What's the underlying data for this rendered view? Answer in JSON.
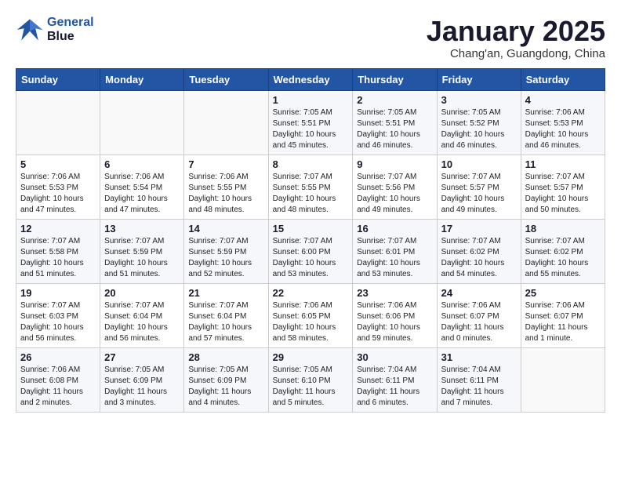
{
  "header": {
    "logo_line1": "General",
    "logo_line2": "Blue",
    "month_title": "January 2025",
    "subtitle": "Chang'an, Guangdong, China"
  },
  "weekdays": [
    "Sunday",
    "Monday",
    "Tuesday",
    "Wednesday",
    "Thursday",
    "Friday",
    "Saturday"
  ],
  "weeks": [
    [
      {
        "day": "",
        "info": ""
      },
      {
        "day": "",
        "info": ""
      },
      {
        "day": "",
        "info": ""
      },
      {
        "day": "1",
        "info": "Sunrise: 7:05 AM\nSunset: 5:51 PM\nDaylight: 10 hours\nand 45 minutes."
      },
      {
        "day": "2",
        "info": "Sunrise: 7:05 AM\nSunset: 5:51 PM\nDaylight: 10 hours\nand 46 minutes."
      },
      {
        "day": "3",
        "info": "Sunrise: 7:05 AM\nSunset: 5:52 PM\nDaylight: 10 hours\nand 46 minutes."
      },
      {
        "day": "4",
        "info": "Sunrise: 7:06 AM\nSunset: 5:53 PM\nDaylight: 10 hours\nand 46 minutes."
      }
    ],
    [
      {
        "day": "5",
        "info": "Sunrise: 7:06 AM\nSunset: 5:53 PM\nDaylight: 10 hours\nand 47 minutes."
      },
      {
        "day": "6",
        "info": "Sunrise: 7:06 AM\nSunset: 5:54 PM\nDaylight: 10 hours\nand 47 minutes."
      },
      {
        "day": "7",
        "info": "Sunrise: 7:06 AM\nSunset: 5:55 PM\nDaylight: 10 hours\nand 48 minutes."
      },
      {
        "day": "8",
        "info": "Sunrise: 7:07 AM\nSunset: 5:55 PM\nDaylight: 10 hours\nand 48 minutes."
      },
      {
        "day": "9",
        "info": "Sunrise: 7:07 AM\nSunset: 5:56 PM\nDaylight: 10 hours\nand 49 minutes."
      },
      {
        "day": "10",
        "info": "Sunrise: 7:07 AM\nSunset: 5:57 PM\nDaylight: 10 hours\nand 49 minutes."
      },
      {
        "day": "11",
        "info": "Sunrise: 7:07 AM\nSunset: 5:57 PM\nDaylight: 10 hours\nand 50 minutes."
      }
    ],
    [
      {
        "day": "12",
        "info": "Sunrise: 7:07 AM\nSunset: 5:58 PM\nDaylight: 10 hours\nand 51 minutes."
      },
      {
        "day": "13",
        "info": "Sunrise: 7:07 AM\nSunset: 5:59 PM\nDaylight: 10 hours\nand 51 minutes."
      },
      {
        "day": "14",
        "info": "Sunrise: 7:07 AM\nSunset: 5:59 PM\nDaylight: 10 hours\nand 52 minutes."
      },
      {
        "day": "15",
        "info": "Sunrise: 7:07 AM\nSunset: 6:00 PM\nDaylight: 10 hours\nand 53 minutes."
      },
      {
        "day": "16",
        "info": "Sunrise: 7:07 AM\nSunset: 6:01 PM\nDaylight: 10 hours\nand 53 minutes."
      },
      {
        "day": "17",
        "info": "Sunrise: 7:07 AM\nSunset: 6:02 PM\nDaylight: 10 hours\nand 54 minutes."
      },
      {
        "day": "18",
        "info": "Sunrise: 7:07 AM\nSunset: 6:02 PM\nDaylight: 10 hours\nand 55 minutes."
      }
    ],
    [
      {
        "day": "19",
        "info": "Sunrise: 7:07 AM\nSunset: 6:03 PM\nDaylight: 10 hours\nand 56 minutes."
      },
      {
        "day": "20",
        "info": "Sunrise: 7:07 AM\nSunset: 6:04 PM\nDaylight: 10 hours\nand 56 minutes."
      },
      {
        "day": "21",
        "info": "Sunrise: 7:07 AM\nSunset: 6:04 PM\nDaylight: 10 hours\nand 57 minutes."
      },
      {
        "day": "22",
        "info": "Sunrise: 7:06 AM\nSunset: 6:05 PM\nDaylight: 10 hours\nand 58 minutes."
      },
      {
        "day": "23",
        "info": "Sunrise: 7:06 AM\nSunset: 6:06 PM\nDaylight: 10 hours\nand 59 minutes."
      },
      {
        "day": "24",
        "info": "Sunrise: 7:06 AM\nSunset: 6:07 PM\nDaylight: 11 hours\nand 0 minutes."
      },
      {
        "day": "25",
        "info": "Sunrise: 7:06 AM\nSunset: 6:07 PM\nDaylight: 11 hours\nand 1 minute."
      }
    ],
    [
      {
        "day": "26",
        "info": "Sunrise: 7:06 AM\nSunset: 6:08 PM\nDaylight: 11 hours\nand 2 minutes."
      },
      {
        "day": "27",
        "info": "Sunrise: 7:05 AM\nSunset: 6:09 PM\nDaylight: 11 hours\nand 3 minutes."
      },
      {
        "day": "28",
        "info": "Sunrise: 7:05 AM\nSunset: 6:09 PM\nDaylight: 11 hours\nand 4 minutes."
      },
      {
        "day": "29",
        "info": "Sunrise: 7:05 AM\nSunset: 6:10 PM\nDaylight: 11 hours\nand 5 minutes."
      },
      {
        "day": "30",
        "info": "Sunrise: 7:04 AM\nSunset: 6:11 PM\nDaylight: 11 hours\nand 6 minutes."
      },
      {
        "day": "31",
        "info": "Sunrise: 7:04 AM\nSunset: 6:11 PM\nDaylight: 11 hours\nand 7 minutes."
      },
      {
        "day": "",
        "info": ""
      }
    ]
  ]
}
